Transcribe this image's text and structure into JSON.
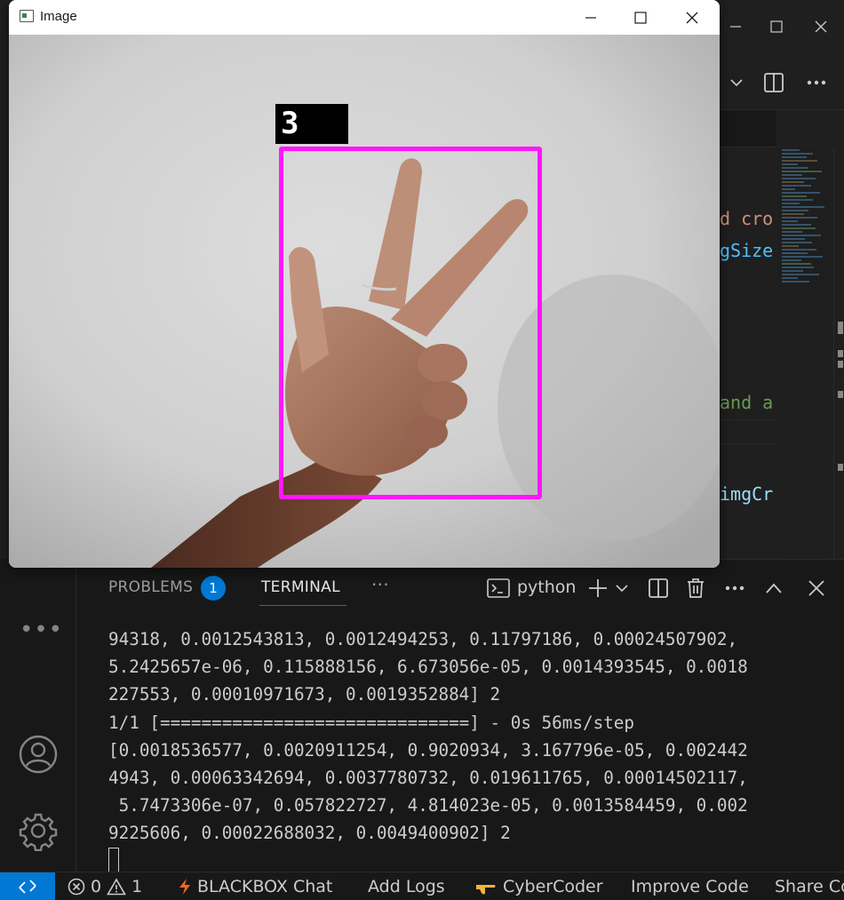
{
  "image_window": {
    "title": "Image",
    "prediction_label": "3",
    "minimize_icon": "minimize-icon",
    "maximize_icon": "maximize-icon",
    "close_icon": "close-icon"
  },
  "editor": {
    "code_fragments": [
      "d cro",
      "gSize",
      "and a",
      "imgCr"
    ]
  },
  "panel": {
    "tabs": [
      {
        "label": "PROBLEMS",
        "badge": "1",
        "active": false
      },
      {
        "label": "TERMINAL",
        "active": true
      }
    ],
    "more_label": "···",
    "terminal_name": "python"
  },
  "terminal": {
    "lines": [
      "94318, 0.0012543813, 0.0012494253, 0.11797186, 0.00024507902,",
      "5.2425657e-06, 0.115888156, 6.673056e-05, 0.0014393545, 0.0018",
      "227553, 0.00010971673, 0.0019352884] 2",
      "1/1 [==============================] - 0s 56ms/step",
      "[0.0018536577, 0.0020911254, 0.9020934, 3.167796e-05, 0.002442",
      "4943, 0.00063342694, 0.0037780732, 0.019611765, 0.00014502117,",
      " 5.7473306e-07, 0.057822727, 4.814023e-05, 0.0013584459, 0.002",
      "9225606, 0.00022688032, 0.0049400902] 2"
    ]
  },
  "statusbar": {
    "errors": "0",
    "warnings": "1",
    "items": [
      "BLACKBOX Chat",
      "Add Logs",
      "CyberCoder",
      "Improve Code",
      "Share Co"
    ]
  },
  "colors": {
    "accent": "#0078d4",
    "bbox": "#ff16ff",
    "vscode_bg": "#1f1f1f"
  }
}
